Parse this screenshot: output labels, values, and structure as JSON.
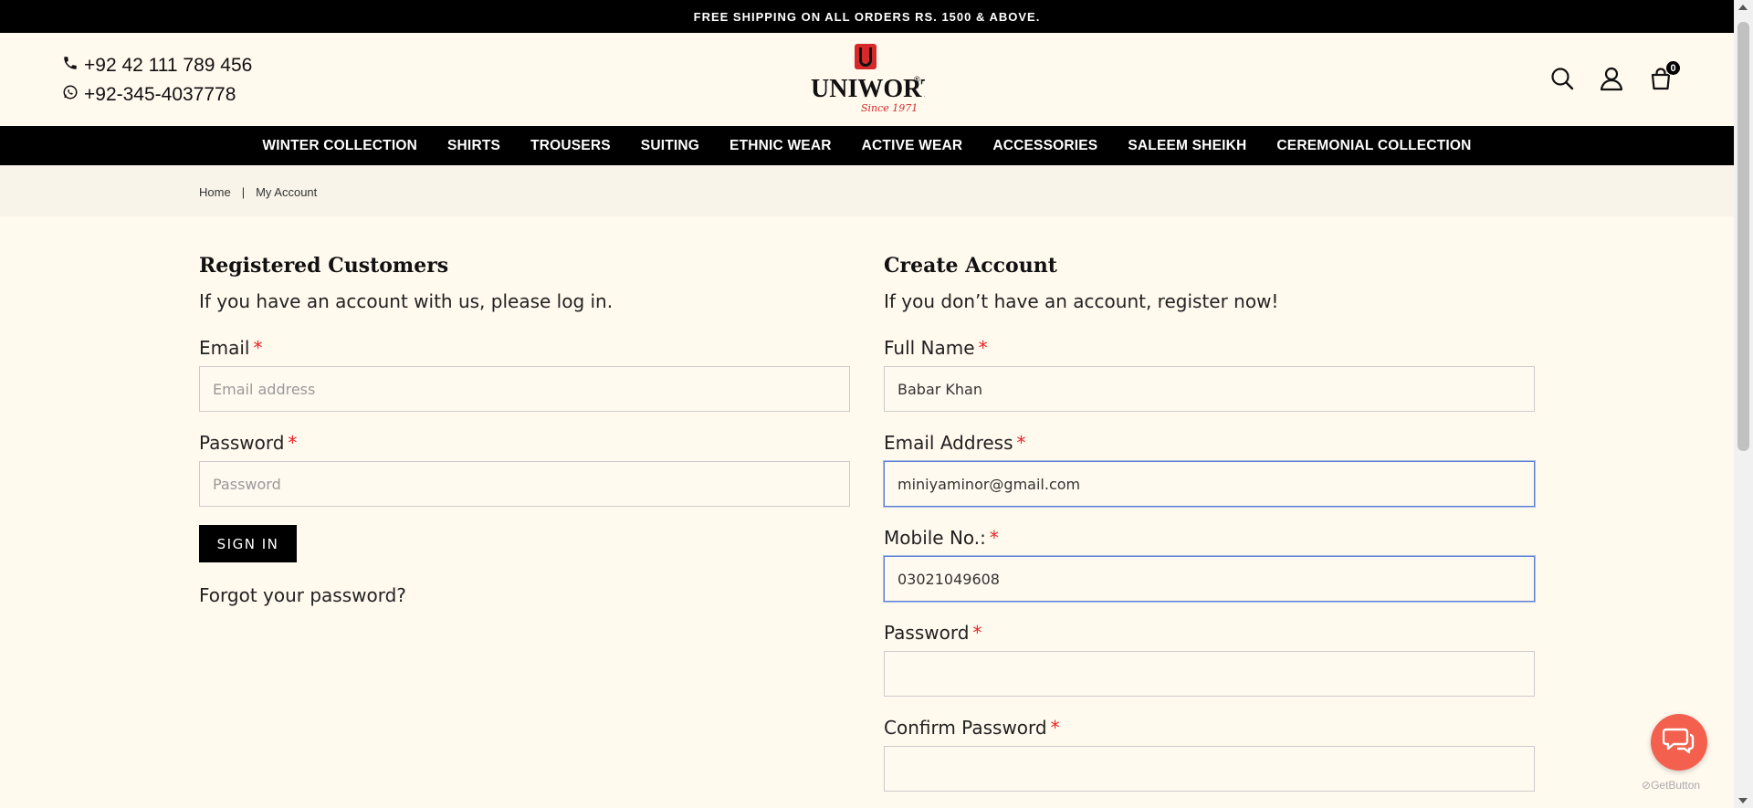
{
  "topbar": {
    "text": "FREE SHIPPING ON ALL ORDERS RS. 1500 & ABOVE."
  },
  "header": {
    "phone": "+92 42 111 789 456",
    "whatsapp": "+92-345-4037778",
    "logo": {
      "letter": "U",
      "brand": "UNIWORTH",
      "since": "Since 1971",
      "registered": "®"
    },
    "cart_count": "0"
  },
  "nav": {
    "items": [
      "WINTER COLLECTION",
      "SHIRTS",
      "TROUSERS",
      "SUITING",
      "ETHNIC WEAR",
      "ACTIVE WEAR",
      "ACCESSORIES",
      "SALEEM SHEIKH",
      "CEREMONIAL COLLECTION"
    ]
  },
  "breadcrumb": {
    "home": "Home",
    "separator": "|",
    "current": "My Account"
  },
  "login": {
    "title": "Registered Customers",
    "intro": "If you have an account with us, please log in.",
    "email_label": "Email",
    "email_placeholder": "Email address",
    "email_value": "",
    "password_label": "Password",
    "password_placeholder": "Password",
    "signin_label": "SIGN IN",
    "forgot_label": "Forgot your password?"
  },
  "register": {
    "title": "Create Account",
    "intro": "If you don’t have an account, register now!",
    "fullname_label": "Full Name",
    "fullname_value": "Babar Khan",
    "email_label": "Email Address",
    "email_value": "miniyaminor@gmail.com",
    "mobile_label": "Mobile No.:",
    "mobile_value": "03021049608",
    "password_label": "Password",
    "confirm_label": "Confirm Password"
  },
  "required_mark": "*",
  "chat": {
    "brand": "GetButton"
  },
  "colors": {
    "accent_red": "#e22",
    "chat": "#f3604e",
    "background": "#fff9ee"
  }
}
